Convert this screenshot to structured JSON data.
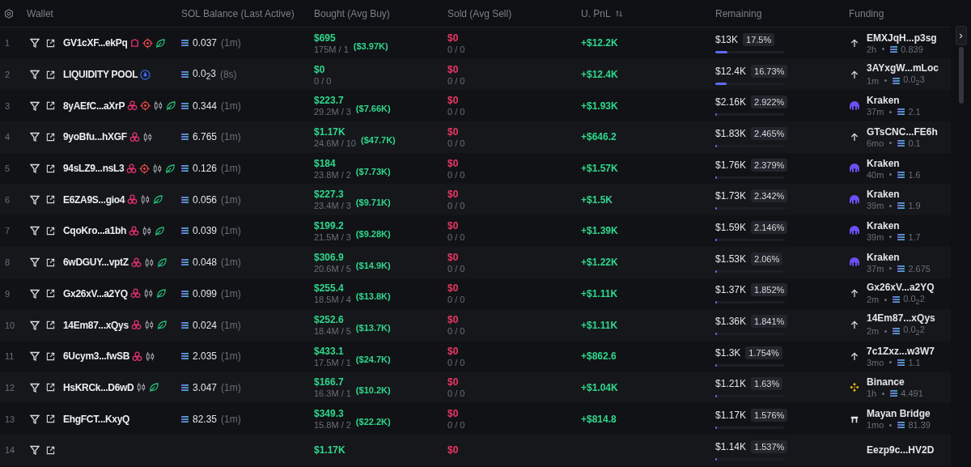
{
  "header": {
    "columns": [
      "Wallet",
      "SOL Balance (Last Active)",
      "Bought (Avg Buy)",
      "Sold (Avg Sell)",
      "U. PnL",
      "Remaining",
      "Funding"
    ]
  },
  "rows": [
    {
      "index": "1",
      "wallet": "GV1cXF...ekPq",
      "tags": [
        {
          "kind": "chef"
        },
        {
          "kind": "target"
        },
        {
          "kind": "leaf"
        }
      ],
      "sol": "0.037",
      "age": "(1m)",
      "bought": "$695",
      "bought_detail": "175M / 1",
      "avg_buy": "($3.97K)",
      "sold": "$0",
      "sold_detail": "0 / 0",
      "pnl": "+$12.2K",
      "remaining": "$13K",
      "percent": "17.5%",
      "level": 0.175,
      "funding": {
        "kind": "wallet",
        "name": "EMXJqH...p3sg",
        "age": "2h",
        "amount": "0.839"
      }
    },
    {
      "index": "2",
      "wallet": "LIQUIDITY POOL",
      "tags": [
        {
          "kind": "pool"
        }
      ],
      "sol": "0.0$_{2}$3",
      "age": "(8s)",
      "bought": "$0",
      "bought_detail": "0 / 0",
      "sold": "$0",
      "sold_detail": "0 / 0",
      "pnl": "+$12.4K",
      "remaining": "$12.4K",
      "percent": "16.73%",
      "level": 0.1673,
      "funding": {
        "kind": "wallet",
        "name": "3AYxgW...mLoc",
        "age": "1m",
        "amount": "0.0$_{2}$3"
      }
    },
    {
      "index": "3",
      "wallet": "8yAEfC...aXrP",
      "tags": [
        {
          "kind": "cluster"
        },
        {
          "kind": "target"
        },
        {
          "kind": "candle"
        },
        {
          "kind": "leaf"
        }
      ],
      "sol": "0.344",
      "age": "(1m)",
      "bought": "$223.7",
      "bought_detail": "29.2M / 3",
      "avg_buy": "($7.66K)",
      "sold": "$0",
      "sold_detail": "0 / 0",
      "pnl": "+$1.93K",
      "remaining": "$2.16K",
      "percent": "2.922%",
      "level": 0.029,
      "funding": {
        "kind": "kraken",
        "name": "Kraken",
        "age": "37m",
        "amount": "2.1"
      }
    },
    {
      "index": "4",
      "wallet": "9yoBfu...hXGF",
      "tags": [
        {
          "kind": "cluster"
        },
        {
          "kind": "candle"
        }
      ],
      "sol": "6.765",
      "age": "(1m)",
      "bought": "$1.17K",
      "bought_detail": "24.6M / 10",
      "avg_buy": "($47.7K)",
      "sold": "$0",
      "sold_detail": "0 / 0",
      "pnl": "+$646.2",
      "remaining": "$1.83K",
      "percent": "2.465%",
      "level": 0.025,
      "funding": {
        "kind": "wallet",
        "name": "GTsCNC...FE6h",
        "age": "6mo",
        "amount": "0.1"
      }
    },
    {
      "index": "5",
      "wallet": "94sLZ9...nsL3",
      "tags": [
        {
          "kind": "cluster"
        },
        {
          "kind": "target"
        },
        {
          "kind": "candle"
        },
        {
          "kind": "leaf"
        }
      ],
      "sol": "0.126",
      "age": "(1m)",
      "bought": "$184",
      "bought_detail": "23.8M / 2",
      "avg_buy": "($7.73K)",
      "sold": "$0",
      "sold_detail": "0 / 0",
      "pnl": "+$1.57K",
      "remaining": "$1.76K",
      "percent": "2.379%",
      "level": 0.024,
      "funding": {
        "kind": "kraken",
        "name": "Kraken",
        "age": "40m",
        "amount": "1.6"
      }
    },
    {
      "index": "6",
      "wallet": "E6ZA9S...gio4",
      "tags": [
        {
          "kind": "cluster"
        },
        {
          "kind": "candle"
        },
        {
          "kind": "leaf"
        }
      ],
      "sol": "0.056",
      "age": "(1m)",
      "bought": "$227.3",
      "bought_detail": "23.4M / 3",
      "avg_buy": "($9.71K)",
      "sold": "$0",
      "sold_detail": "0 / 0",
      "pnl": "+$1.5K",
      "remaining": "$1.73K",
      "percent": "2.342%",
      "level": 0.023,
      "funding": {
        "kind": "kraken",
        "name": "Kraken",
        "age": "39m",
        "amount": "1.9"
      }
    },
    {
      "index": "7",
      "wallet": "CqoKro...a1bh",
      "tags": [
        {
          "kind": "cluster"
        },
        {
          "kind": "candle"
        },
        {
          "kind": "leaf"
        }
      ],
      "sol": "0.039",
      "age": "(1m)",
      "bought": "$199.2",
      "bought_detail": "21.5M / 3",
      "avg_buy": "($9.28K)",
      "sold": "$0",
      "sold_detail": "0 / 0",
      "pnl": "+$1.39K",
      "remaining": "$1.59K",
      "percent": "2.146%",
      "level": 0.021,
      "funding": {
        "kind": "kraken",
        "name": "Kraken",
        "age": "39m",
        "amount": "1.7"
      }
    },
    {
      "index": "8",
      "wallet": "6wDGUY...vptZ",
      "tags": [
        {
          "kind": "cluster"
        },
        {
          "kind": "candle"
        },
        {
          "kind": "leaf"
        }
      ],
      "sol": "0.048",
      "age": "(1m)",
      "bought": "$306.9",
      "bought_detail": "20.6M / 5",
      "avg_buy": "($14.9K)",
      "sold": "$0",
      "sold_detail": "0 / 0",
      "pnl": "+$1.22K",
      "remaining": "$1.53K",
      "percent": "2.06%",
      "level": 0.021,
      "funding": {
        "kind": "kraken",
        "name": "Kraken",
        "age": "37m",
        "amount": "2.675"
      }
    },
    {
      "index": "9",
      "wallet": "Gx26xV...a2YQ",
      "tags": [
        {
          "kind": "cluster"
        },
        {
          "kind": "candle"
        },
        {
          "kind": "leaf"
        }
      ],
      "sol": "0.099",
      "age": "(1m)",
      "bought": "$255.4",
      "bought_detail": "18.5M / 4",
      "avg_buy": "($13.8K)",
      "sold": "$0",
      "sold_detail": "0 / 0",
      "pnl": "+$1.11K",
      "remaining": "$1.37K",
      "percent": "1.852%",
      "level": 0.019,
      "funding": {
        "kind": "wallet",
        "name": "Gx26xV...a2YQ",
        "age": "2m",
        "amount": "0.0$_{2}$2"
      }
    },
    {
      "index": "10",
      "wallet": "14Em87...xQys",
      "tags": [
        {
          "kind": "cluster"
        },
        {
          "kind": "candle"
        },
        {
          "kind": "leaf"
        }
      ],
      "sol": "0.024",
      "age": "(1m)",
      "bought": "$252.6",
      "bought_detail": "18.4M / 5",
      "avg_buy": "($13.7K)",
      "sold": "$0",
      "sold_detail": "0 / 0",
      "pnl": "+$1.11K",
      "remaining": "$1.36K",
      "percent": "1.841%",
      "level": 0.018,
      "funding": {
        "kind": "wallet",
        "name": "14Em87...xQys",
        "age": "2m",
        "amount": "0.0$_{2}$2"
      }
    },
    {
      "index": "11",
      "wallet": "6Ucym3...fwSB",
      "tags": [
        {
          "kind": "cluster"
        },
        {
          "kind": "candle"
        }
      ],
      "sol": "2.035",
      "age": "(1m)",
      "bought": "$433.1",
      "bought_detail": "17.5M / 1",
      "avg_buy": "($24.7K)",
      "sold": "$0",
      "sold_detail": "0 / 0",
      "pnl": "+$862.6",
      "remaining": "$1.3K",
      "percent": "1.754%",
      "level": 0.018,
      "funding": {
        "kind": "wallet",
        "name": "7c1Zxz...w3W7",
        "age": "3mo",
        "amount": "1.1"
      }
    },
    {
      "index": "12",
      "wallet": "HsKRCk...D6wD",
      "tags": [
        {
          "kind": "candle"
        },
        {
          "kind": "leaf"
        }
      ],
      "sol": "3.047",
      "age": "(1m)",
      "bought": "$166.7",
      "bought_detail": "16.3M / 1",
      "avg_buy": "($10.2K)",
      "sold": "$0",
      "sold_detail": "0 / 0",
      "pnl": "+$1.04K",
      "remaining": "$1.21K",
      "percent": "1.63%",
      "level": 0.016,
      "funding": {
        "kind": "binance",
        "name": "Binance",
        "age": "1h",
        "amount": "4.491"
      }
    },
    {
      "index": "13",
      "wallet": "EhgFCT...KxyQ",
      "tags": [],
      "sol": "82.35",
      "age": "(1m)",
      "bought": "$349.3",
      "bought_detail": "15.8M / 2",
      "avg_buy": "($22.2K)",
      "sold": "$0",
      "sold_detail": "0 / 0",
      "pnl": "+$814.8",
      "remaining": "$1.17K",
      "percent": "1.576%",
      "level": 0.016,
      "funding": {
        "kind": "bridge",
        "name": "Mayan Bridge",
        "age": "1mo",
        "amount": "81.39"
      }
    },
    {
      "index": "14",
      "bought": "$1.17K",
      "sold": "$0",
      "remaining": "$1.14K",
      "percent": "1.537%",
      "level": 0.015,
      "funding": {
        "name": "Eezp9c...HV2D"
      }
    }
  ]
}
